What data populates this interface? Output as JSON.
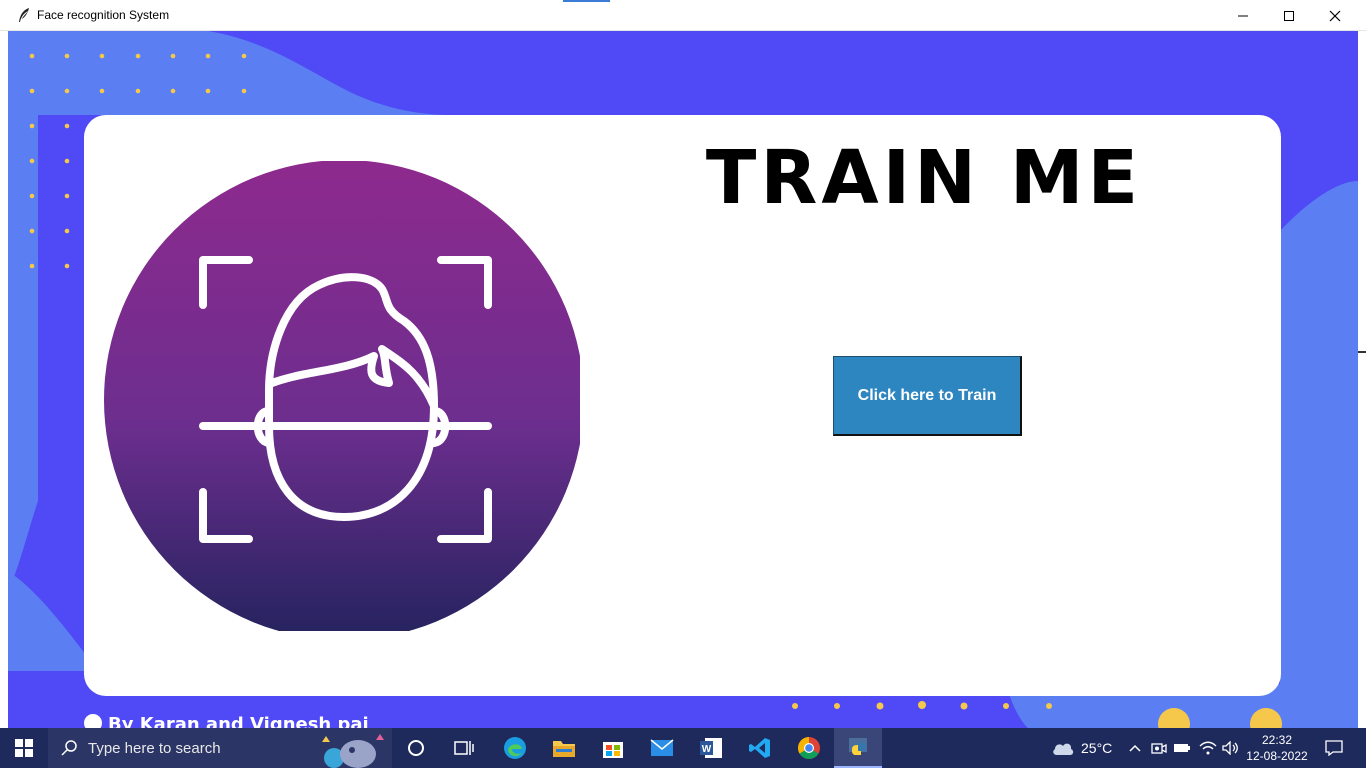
{
  "window": {
    "title": "Face recognition System"
  },
  "main": {
    "heading": "TRAIN ME",
    "train_button_label": "Click here to Train",
    "credit": "By Karan and Vignesh pai"
  },
  "taskbar": {
    "search_placeholder": "Type here to search",
    "weather": "25°C",
    "time": "22:32",
    "date": "12-08-2022"
  },
  "colors": {
    "app_background": "#4f49f6",
    "wave": "#5b7ff2",
    "card": "#ffffff",
    "button": "#2e86c1",
    "circle_top": "#8e2a8e",
    "circle_bottom": "#24235e",
    "dots": "#f5c84c"
  },
  "icons": {
    "app": "feather-icon",
    "face": "face-scan-icon"
  }
}
